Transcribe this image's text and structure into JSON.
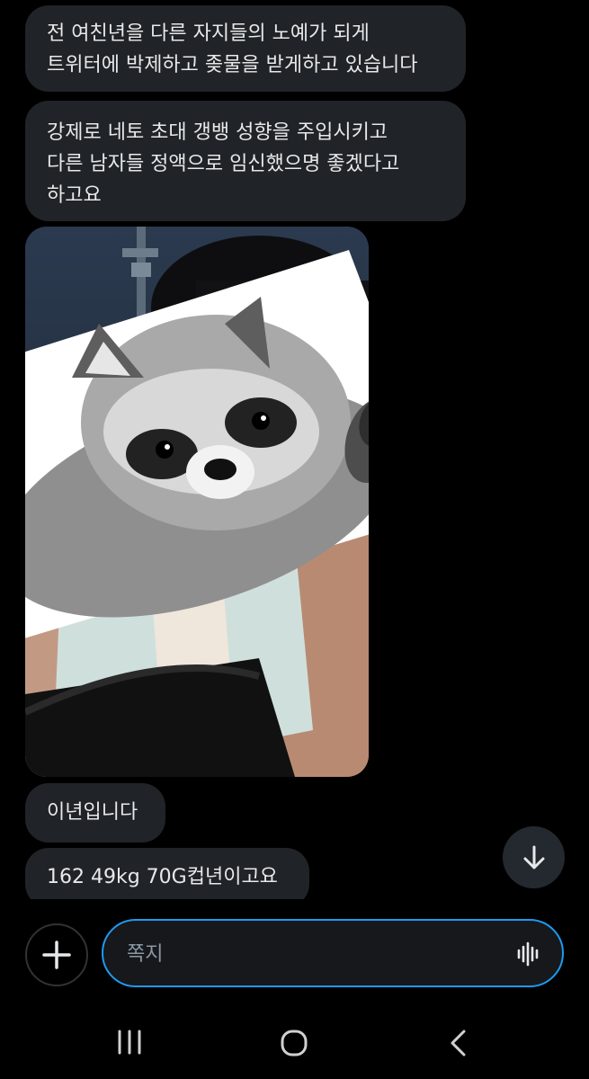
{
  "messages": [
    {
      "text": "전 여친년을 다른 자지들의 노예가 되게\n트위터에 박제하고 좆물을 받게하고 있습니다"
    },
    {
      "text": "강제로 네토 초대 갱뱅 성향을 주입시키고\n다른 남자들 정액으로 임신했으명 좋겠다고\n하고요"
    },
    {
      "text": "이년입니다"
    },
    {
      "text": "162 49kg 70G컵년이고요"
    }
  ],
  "composer": {
    "placeholder": "쪽지"
  },
  "icons": {
    "scroll": "arrow-down-icon",
    "add": "plus-icon",
    "voice": "voice-wave-icon",
    "nav": [
      "recent-apps-icon",
      "home-icon",
      "back-icon"
    ]
  },
  "colors": {
    "background": "#000000",
    "bubble": "#202327",
    "accent": "#1d9bf0"
  }
}
